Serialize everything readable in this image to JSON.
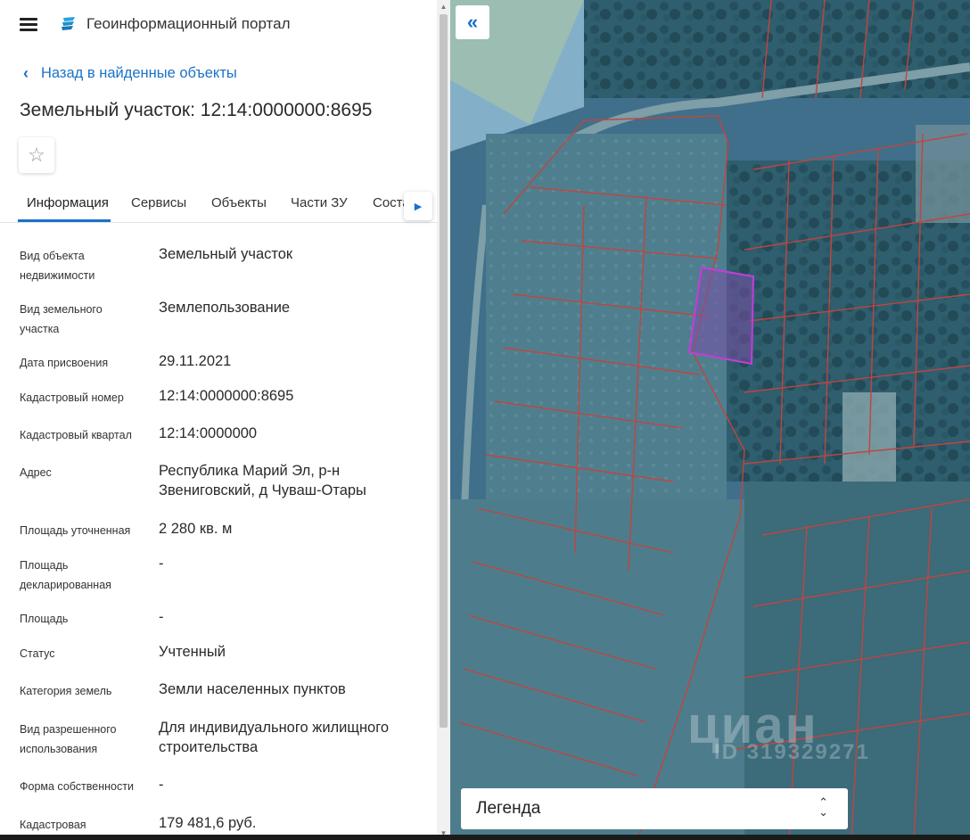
{
  "app": {
    "title": "Геоинформационный портал",
    "menu_icon": "hamburger-menu-icon",
    "logo_icon": "portal-logo-icon"
  },
  "nav": {
    "back_label": "Назад в найденные объекты"
  },
  "object": {
    "title": "Земельный участок: 12:14:0000000:8695",
    "favorite_icon": "star-outline-icon"
  },
  "tabs": [
    {
      "label": "Информация",
      "active": true
    },
    {
      "label": "Сервисы"
    },
    {
      "label": "Объекты"
    },
    {
      "label": "Части ЗУ"
    },
    {
      "label": "Соста"
    }
  ],
  "properties": [
    {
      "key": "Вид объекта недвижимости",
      "value": "Земельный участок"
    },
    {
      "key": "Вид земельного участка",
      "value": "Землепользование"
    },
    {
      "key": "Дата присвоения",
      "value": "29.11.2021"
    },
    {
      "key": "Кадастровый номер",
      "value": "12:14:0000000:8695"
    },
    {
      "key": "Кадастровый квартал",
      "value": "12:14:0000000"
    },
    {
      "key": "Адрес",
      "value": "Республика Марий Эл, р-н Звениговский, д Чуваш-Отары"
    },
    {
      "key": "Площадь уточненная",
      "value": "2 280 кв. м"
    },
    {
      "key": "Площадь декларированная",
      "value": "-"
    },
    {
      "key": "Площадь",
      "value": "-"
    },
    {
      "key": "Статус",
      "value": "Учтенный"
    },
    {
      "key": "Категория земель",
      "value": "Земли населенных пунктов"
    },
    {
      "key": "Вид разрешенного использования",
      "value": "Для индивидуального жилищного строительства"
    },
    {
      "key": "Форма собственности",
      "value": "-"
    },
    {
      "key": "Кадастровая",
      "value": "179 481,6 руб."
    }
  ],
  "map": {
    "collapse_icon": "double-chevron-left-icon",
    "watermark": "циан",
    "watermark_id": "ID 319329271",
    "legend_label": "Легенда",
    "legend_toggle_icon": "chevron-up-down-icon",
    "colors": {
      "parcel_border": "#c0453f",
      "selected_parcel": "#c43dd8",
      "overlay_blue": "#3f72a8"
    }
  }
}
